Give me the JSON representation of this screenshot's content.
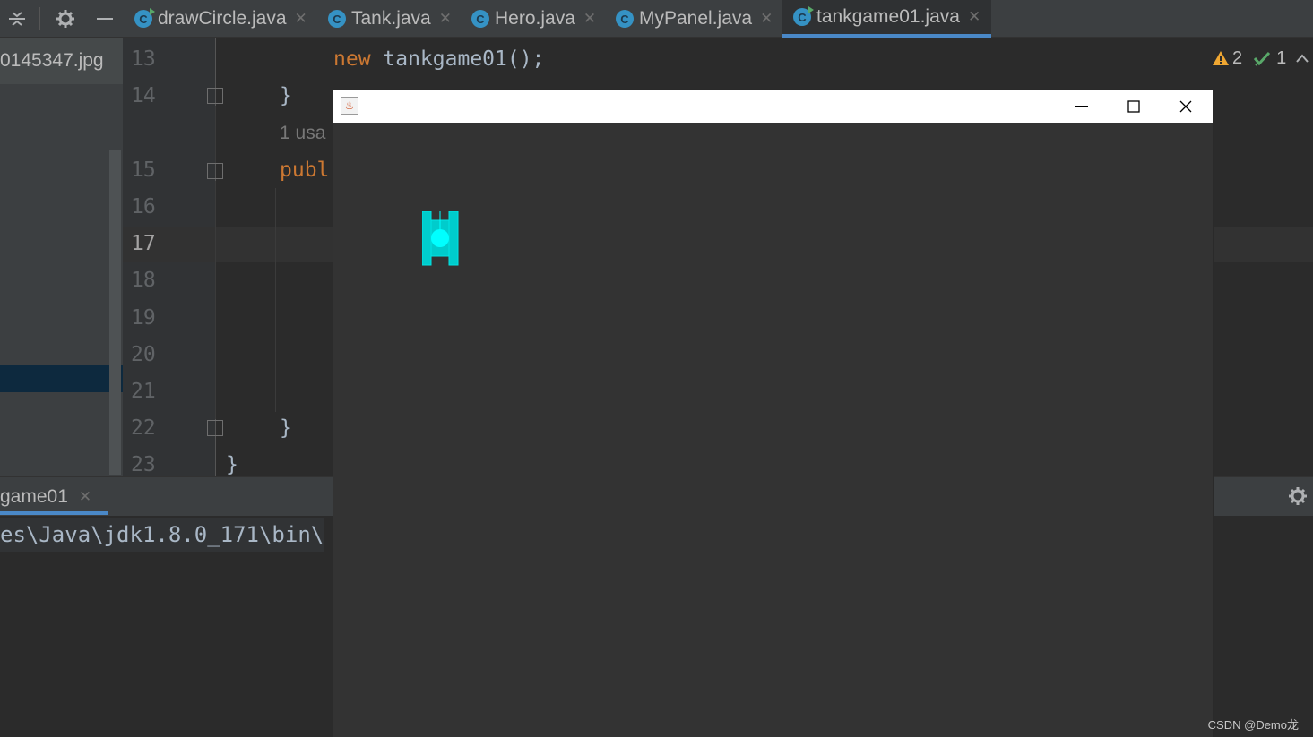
{
  "toolbar": {
    "icons": [
      "collapse-icon",
      "gear-icon",
      "minimize-icon"
    ]
  },
  "tabs": [
    {
      "label": "drawCircle.java",
      "icon": "C"
    },
    {
      "label": "Tank.java",
      "icon": "C"
    },
    {
      "label": "Hero.java",
      "icon": "C"
    },
    {
      "label": "MyPanel.java",
      "icon": "C"
    },
    {
      "label": "tankgame01.java",
      "icon": "C",
      "active": true
    }
  ],
  "project": {
    "file_label": "0145347.jpg"
  },
  "editor": {
    "line_numbers": [
      "13",
      "14",
      "15",
      "16",
      "17",
      "18",
      "19",
      "20",
      "21",
      "22",
      "23"
    ],
    "current_line": "17",
    "code": {
      "line13_kw": "new",
      "line13_rest": " tankgame01();",
      "line14": "}",
      "usages_hint": "1 usa",
      "line15_kw": "publ",
      "line22": "}",
      "line23": "}"
    },
    "inspections": {
      "warnings": "2",
      "ok": "1"
    }
  },
  "run": {
    "tab_label": "game01",
    "command": "es\\Java\\jdk1.8.0_171\\bin\\"
  },
  "swing_window": {
    "title": "",
    "controls": [
      "minimize",
      "maximize",
      "close"
    ],
    "background": "#333333",
    "tank_color": "#00cccc"
  },
  "watermark": "CSDN @Demo龙",
  "colors": {
    "ide_bg": "#2b2b2b",
    "panel_bg": "#3c3f41",
    "keyword": "#cc7832",
    "text": "#a9b7c6",
    "accent": "#4a88c7"
  }
}
